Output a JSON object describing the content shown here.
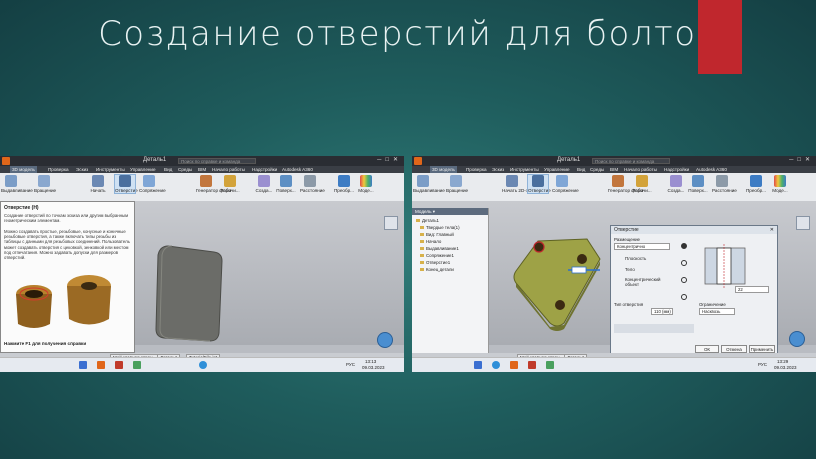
{
  "slide": {
    "title": "Создание отверстий для болтов",
    "accent_color": "#c0272d"
  },
  "left": {
    "window_title": "Деталь1",
    "search_placeholder": "Поиск по справке и команда",
    "menu": [
      "3D модель",
      "Проверка",
      "Эскиз",
      "Инструменты",
      "Управление",
      "Вид",
      "Среды",
      "BIM",
      "Начало работы",
      "Надстройки",
      "Autodesk A360"
    ],
    "active_menu": "3D модель",
    "ribbon": [
      "Выдавливание",
      "Вращение",
      "Начать",
      "Отверстие",
      "Сопряжение",
      "Генератор форм",
      "Рабочи...",
      "Созда...",
      "Поверх...",
      "Расстояние",
      "Преобр...",
      "Моде..."
    ],
    "tooltip": {
      "title": "Отверстие (H)",
      "text1": "Создание отверстий по точкам эскиза или другим выбранным геометрическим элементам.",
      "text2": "Можно создавать простые, резьбовые, конусные и коничные резьбовые отверстия, а также включать типы резьбы из таблицы с данными для резьбовых соединений. Пользователь может создавать отверстия с цековкой, зенковкой или местом под отпечатания. Можно задавать допуски для размеров отверстий.",
      "hint": "Нажмите F1 для получения справки"
    },
    "tabs": [
      "Мой главная стран...",
      "Деталь1",
      "TutorialFile.ipt"
    ],
    "page_nums": [
      "1",
      "2"
    ],
    "status": "Для вызова справки нажмите F1",
    "taskbar": {
      "time": "13:13",
      "date": "09.03.2023",
      "lang": "РУС"
    }
  },
  "right": {
    "window_title": "Деталь1",
    "search_placeholder": "Поиск по справке и команда",
    "menu": [
      "3D модель",
      "Проверка",
      "Эскиз",
      "Инструменты",
      "Управление",
      "Вид",
      "Среды",
      "BIM",
      "Начало работы",
      "Надстройки",
      "Autodesk A360"
    ],
    "active_menu": "3D модель",
    "ribbon": [
      "Выдавливание",
      "Вращение",
      "Начать 2D-эскиз",
      "Отверстие",
      "Сопряжение",
      "Генератор форм",
      "Рабочи...",
      "Созда...",
      "Поверх...",
      "Расстояние",
      "Преобр...",
      "Моде..."
    ],
    "browser": {
      "header": "Модель ▾",
      "items": [
        "Деталь1",
        "Твердые тела(1)",
        "Вид: Главный",
        "Начало",
        "Выдавливание1",
        "Сопряжение1",
        "Отверстие1",
        "Конец детали"
      ]
    },
    "dialog": {
      "title": "Отверстие",
      "placement_label": "Размещение",
      "placement_value": "Концентрично",
      "plane_label": "Плоскость",
      "ring_label": "Тело",
      "ref_label": "Концентрический объект",
      "type_label": "Тип отверстия",
      "thread_value": "110 (мм)",
      "limit_label": "Ограничение",
      "limit_value": "Насквозь",
      "diameter_value": "22",
      "buttons": [
        "ОК",
        "Отмена",
        "Применить"
      ]
    },
    "tabs": [
      "Мой главная стран...",
      "Деталь1"
    ],
    "page_nums": [
      "1",
      "2"
    ],
    "status": "Режим ожидания",
    "taskbar": {
      "time": "13:29",
      "date": "09.03.2023",
      "lang": "РУС"
    }
  }
}
